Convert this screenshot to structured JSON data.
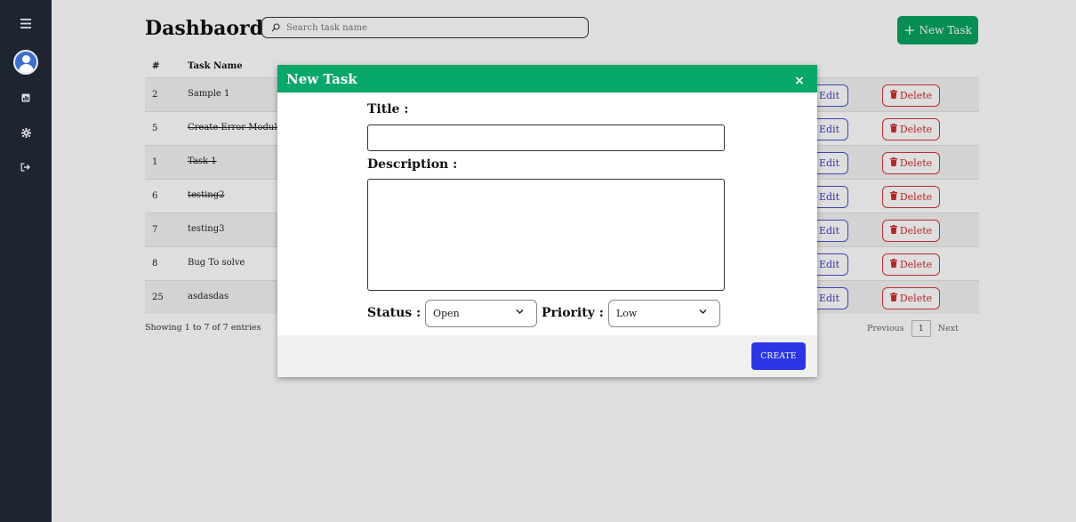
{
  "sidebar": {
    "icons": [
      "menu-icon",
      "user-avatar-icon",
      "dashboard-icon",
      "settings-icon",
      "logout-icon"
    ]
  },
  "header": {
    "title": "Dashbaord",
    "search_placeholder": "Search task name",
    "new_task_label": "New Task",
    "new_task_plus": "+"
  },
  "table": {
    "headers": {
      "num": "#",
      "name": "Task Name"
    },
    "rows": [
      {
        "num": "2",
        "name": "Sample 1",
        "done": false
      },
      {
        "num": "5",
        "name": "Create Error Module",
        "done": true
      },
      {
        "num": "1",
        "name": "Task 1",
        "done": true
      },
      {
        "num": "6",
        "name": "testing2",
        "done": true
      },
      {
        "num": "7",
        "name": "testing3",
        "done": false
      },
      {
        "num": "8",
        "name": "Bug To solve",
        "done": false
      },
      {
        "num": "25",
        "name": "asdasdas",
        "done": false
      }
    ],
    "edit_label": "Edit",
    "delete_label": "Delete",
    "entries_text": "Showing 1 to 7 of 7 entries",
    "pagination": {
      "previous": "Previous",
      "page": "1",
      "next": "Next"
    }
  },
  "modal": {
    "title": "New Task",
    "close": "×",
    "title_label": "Title :",
    "description_label": "Description :",
    "status_label": "Status :",
    "status_value": "Open",
    "priority_label": "Priority :",
    "priority_value": "Low",
    "create_label": "CREATE"
  },
  "colors": {
    "sidebar_bg": "#1e2530",
    "accent_green": "#08a460",
    "edit_blue": "#3c40c9",
    "delete_red": "#d02c2c",
    "create_blue": "#2c35e3"
  }
}
